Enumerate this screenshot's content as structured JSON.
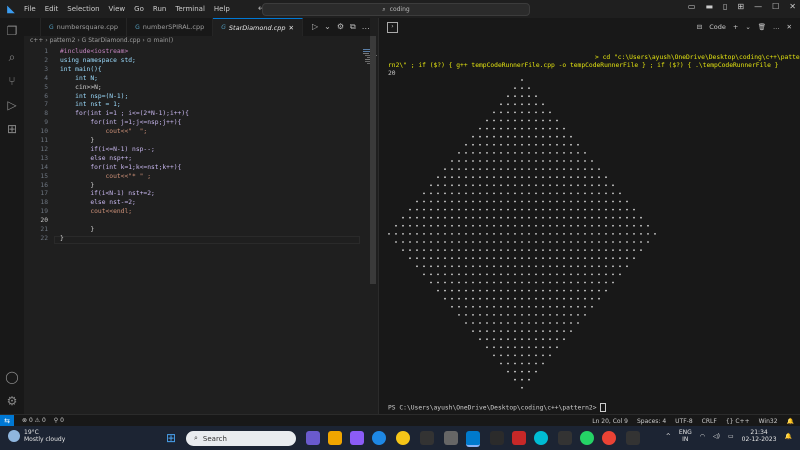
{
  "menu": [
    "File",
    "Edit",
    "Selection",
    "View",
    "Go",
    "Run",
    "Terminal",
    "Help"
  ],
  "search": {
    "text": "coding"
  },
  "tabs": [
    {
      "label": "numbersquare.cpp"
    },
    {
      "label": "numberSPIRAL.cpp"
    },
    {
      "label": "StarDiamond.cpp",
      "active": true
    }
  ],
  "breadcrumb": "c++ › pattern2 › G StarDiamond.cpp › ⊙ main()",
  "code_lines": [
    "#include<iostream>",
    "using namespace std;",
    "int main(){",
    "    int N;",
    "    cin>>N;",
    "    int nsp=(N-1);",
    "    int nst = 1;",
    "    for(int i=1 ; i<=(2*N-1);i++){",
    "        for(int j=1;j<=nsp;j++){",
    "            cout<<\"  \";",
    "        }",
    "        if(i<=N-1) nsp--;",
    "        else nsp++;",
    "        for(int k=1;k<=nst;k++){",
    "            cout<<\"* \" ;",
    "        }",
    "        if(i<N-1) nst+=2;",
    "        else nst-=2;",
    "        cout<<endl;",
    "",
    "        }",
    "}"
  ],
  "terminal": {
    "header_label": "Code",
    "cmd_line1": "> cd \"c:\\Users\\ayush\\OneDrive\\Desktop\\coding\\c++\\patte",
    "cmd_line2": "rn2\\\" ; if ($?) { g++ tempCodeRunnerFile.cpp -o tempCodeRunnerFile } ; if ($?) { .\\tempCodeRunnerFile }",
    "input": "20",
    "prompt": "PS C:\\Users\\ayush\\OneDrive\\Desktop\\coding\\c++\\pattern2> ",
    "diamond_n": 20
  },
  "status": {
    "errors": "0",
    "warnings": "0",
    "ports": "0",
    "position": "Ln 20, Col 9",
    "spaces": "Spaces: 4",
    "encoding": "UTF-8",
    "eol": "CRLF",
    "language": "C++",
    "platform": "Win32"
  },
  "taskbar": {
    "temp": "19°C",
    "weather": "Mostly cloudy",
    "search_placeholder": "Search",
    "lang1": "ENG",
    "lang2": "IN",
    "time": "21:34",
    "date": "02-12-2023"
  },
  "colors": {
    "accent": "#0078d4",
    "editor_bg": "#1f1f1f",
    "panel_bg": "#181818"
  }
}
